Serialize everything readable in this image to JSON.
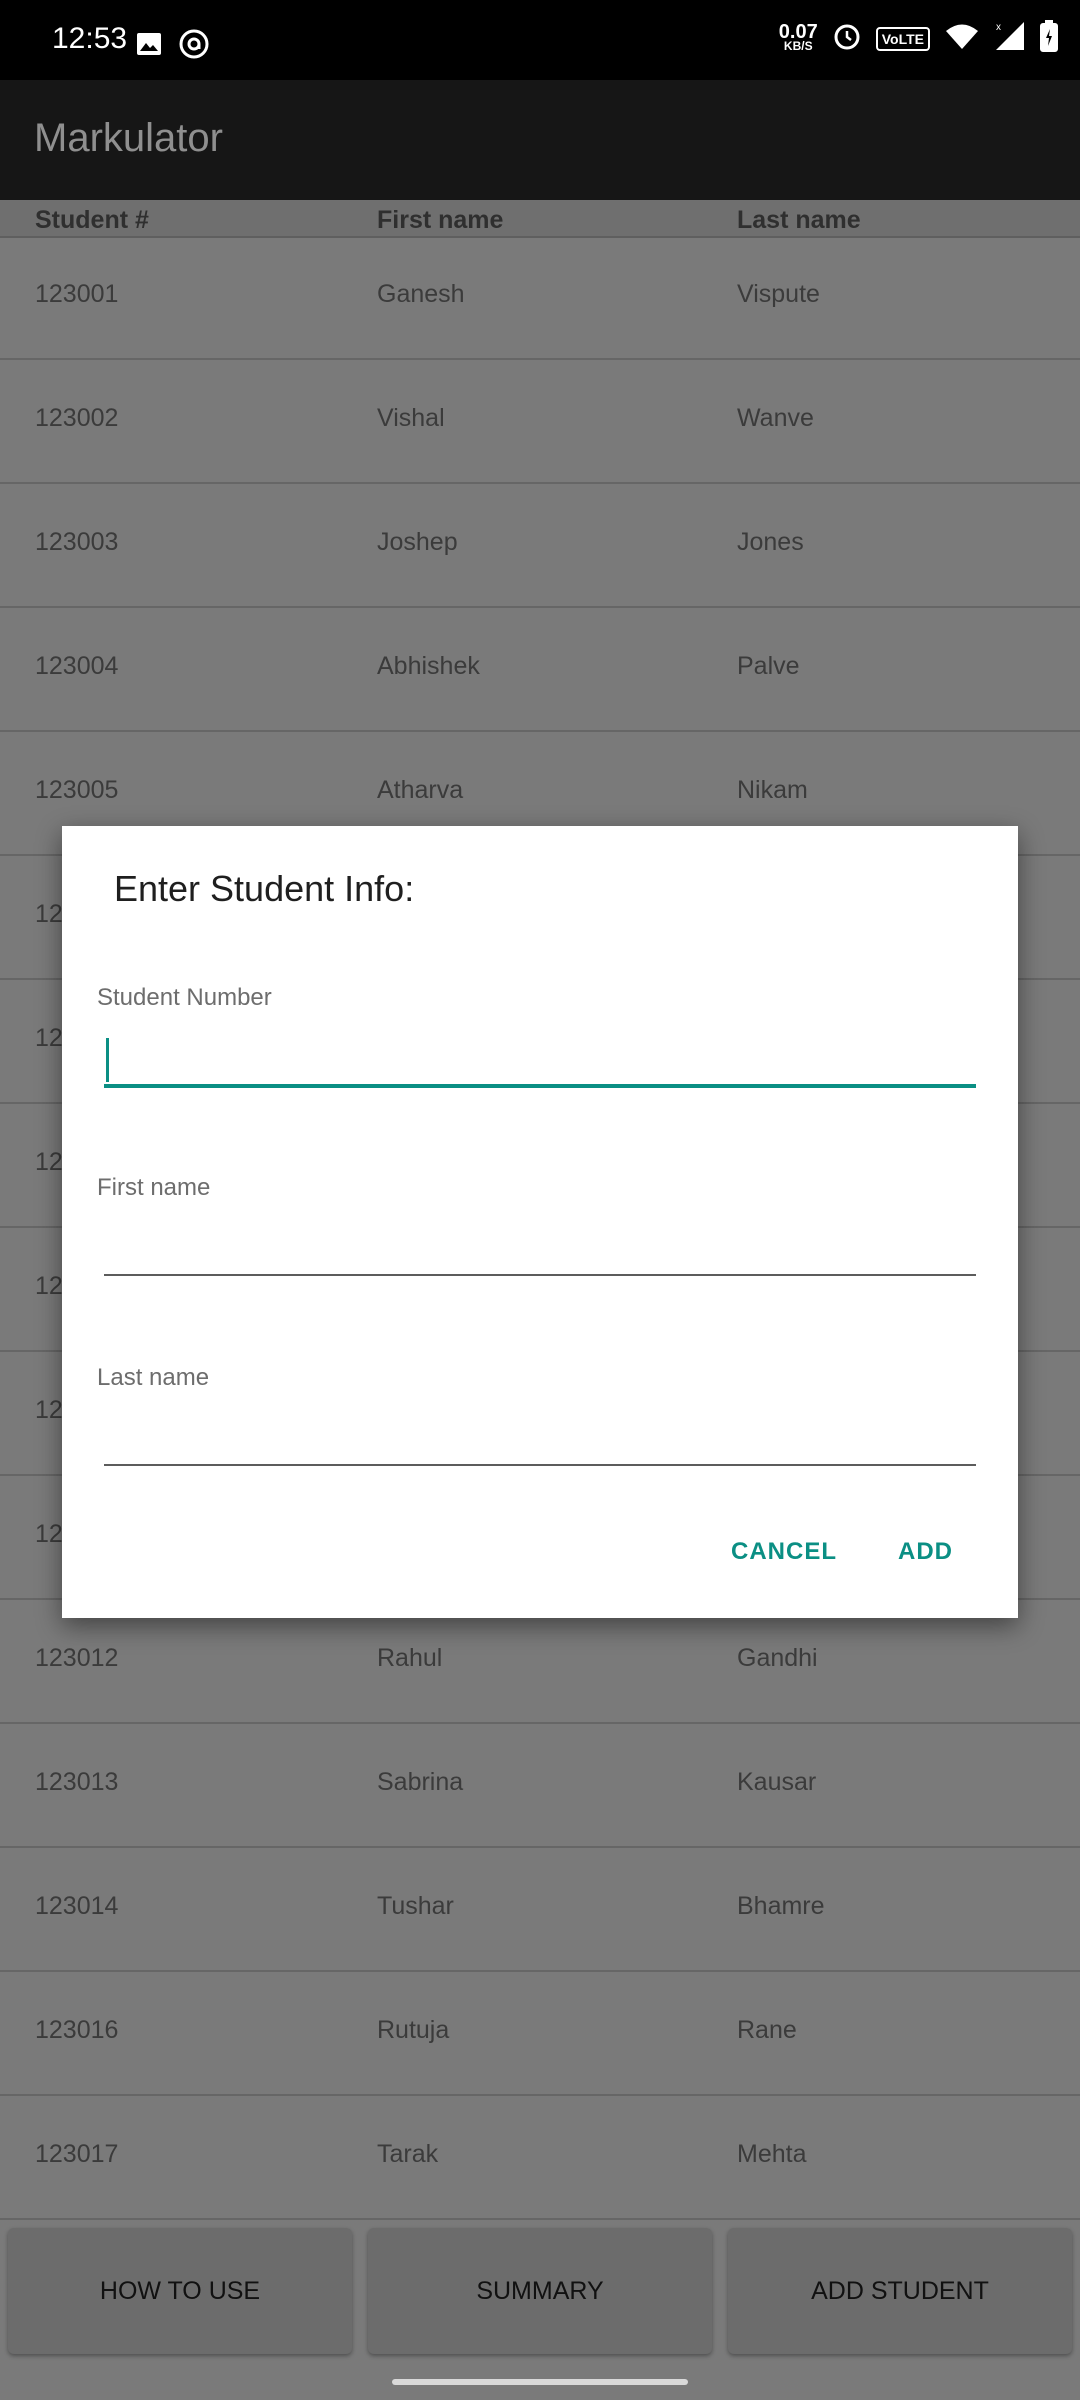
{
  "status_bar": {
    "time": "12:53",
    "net_speed_value": "0.07",
    "net_speed_unit": "KB/S",
    "volte": "VoLTE",
    "icons": [
      "image-icon",
      "at-sign-icon",
      "alarm-icon",
      "wifi-icon",
      "signal-icon",
      "battery-icon"
    ]
  },
  "app_bar": {
    "title": "Markulator"
  },
  "table": {
    "headers": [
      "Student #",
      "First name",
      "Last name"
    ],
    "rows": [
      [
        "123001",
        "Ganesh",
        "Vispute"
      ],
      [
        "123002",
        "Vishal",
        "Wanve"
      ],
      [
        "123003",
        "Joshep",
        "Jones"
      ],
      [
        "123004",
        "Abhishek",
        "Palve"
      ],
      [
        "123005",
        "Atharva",
        "Nikam"
      ],
      [
        "12",
        "",
        ""
      ],
      [
        "12",
        "",
        ""
      ],
      [
        "12",
        "",
        ""
      ],
      [
        "12",
        "",
        ""
      ],
      [
        "12",
        "",
        ""
      ],
      [
        "12",
        "",
        ""
      ],
      [
        "123012",
        "Rahul",
        "Gandhi"
      ],
      [
        "123013",
        "Sabrina",
        "Kausar"
      ],
      [
        "123014",
        "Tushar",
        "Bhamre"
      ],
      [
        "123016",
        "Rutuja",
        "Rane"
      ],
      [
        "123017",
        "Tarak",
        "Mehta"
      ]
    ]
  },
  "bottom_buttons": {
    "how_to_use": "HOW TO USE",
    "summary": "SUMMARY",
    "add_student": "ADD STUDENT"
  },
  "dialog": {
    "title": "Enter Student Info:",
    "student_number_label": "Student Number",
    "student_number_value": "",
    "first_name_label": "First name",
    "first_name_value": "",
    "last_name_label": "Last name",
    "last_name_value": "",
    "cancel": "CANCEL",
    "add": "ADD"
  },
  "colors": {
    "accent": "#0b8f84",
    "appbar": "#161616",
    "scrim_background": "#7a7a7a"
  }
}
